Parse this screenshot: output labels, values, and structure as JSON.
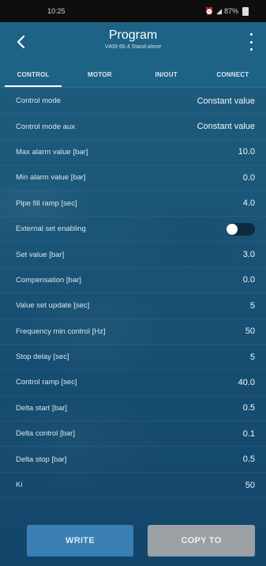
{
  "status_bar": {
    "time": "10:25",
    "indicators": "87%"
  },
  "header": {
    "title": "Program",
    "subtitle": "V409 66.4 Stand-alone"
  },
  "tabs": [
    {
      "label": "CONTROL",
      "active": true
    },
    {
      "label": "MOTOR",
      "active": false
    },
    {
      "label": "IN/OUT",
      "active": false
    },
    {
      "label": "CONNECT",
      "active": false
    }
  ],
  "rows": [
    {
      "label": "Control mode",
      "value": "Constant value"
    },
    {
      "label": "Control mode aux",
      "value": "Constant value"
    },
    {
      "label": "Max alarm value [bar]",
      "value": "10.0"
    },
    {
      "label": "Min alarm value [bar]",
      "value": "0.0"
    },
    {
      "label": "Pipe fill ramp [sec]",
      "value": "4.0"
    },
    {
      "label": "External set enabling",
      "value": "",
      "toggle": false
    },
    {
      "label": "Set value [bar]",
      "value": "3.0"
    },
    {
      "label": "Compensation [bar]",
      "value": "0.0"
    },
    {
      "label": "Value set update [sec]",
      "value": "5"
    },
    {
      "label": "Frequency min control [Hz]",
      "value": "50"
    },
    {
      "label": "Stop delay [sec]",
      "value": "5"
    },
    {
      "label": "Control ramp [sec]",
      "value": "40.0"
    },
    {
      "label": "Delta start [bar]",
      "value": "0.5"
    },
    {
      "label": "Delta control [bar]",
      "value": "0.1"
    },
    {
      "label": "Delta stop [bar]",
      "value": "0.5"
    },
    {
      "label": "Ki",
      "value": "50"
    }
  ],
  "buttons": {
    "write": "WRITE",
    "copy": "COPY TO"
  },
  "colors": {
    "header": "#1e6285",
    "background": "#1c587a",
    "write_button": "#3a7fb4",
    "copy_button": "#9aa0a4"
  }
}
